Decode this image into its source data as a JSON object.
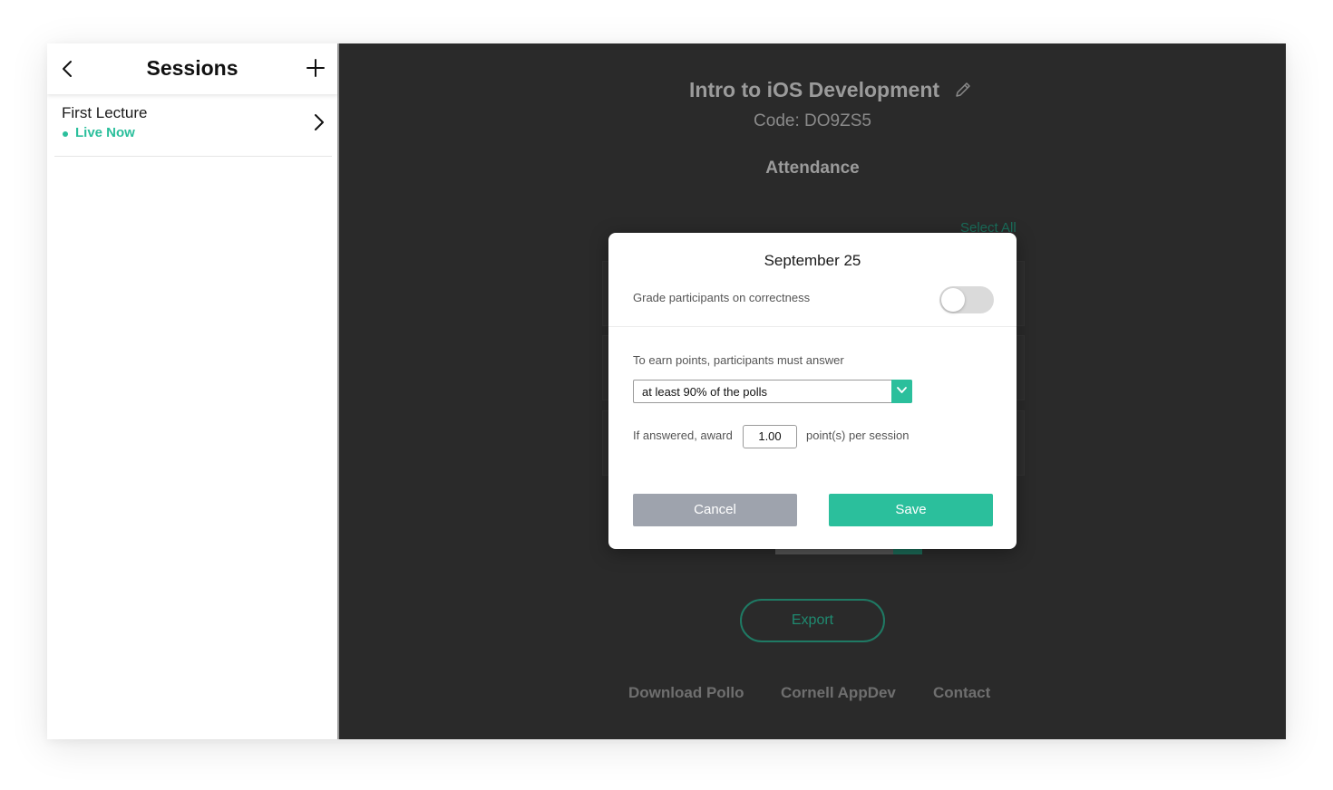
{
  "sidebar": {
    "title": "Sessions",
    "items": [
      {
        "name": "First Lecture",
        "status": "Live Now"
      }
    ]
  },
  "main": {
    "course_title": "Intro to iOS Development",
    "course_code": "Code: DO9ZS5",
    "section_title": "Attendance",
    "select_all": "Select All",
    "export_label": "Export",
    "footer_links": [
      "Download Pollo",
      "Cornell AppDev",
      "Contact"
    ]
  },
  "modal": {
    "title": "September 25",
    "grade_label": "Grade participants on correctness",
    "grade_toggle_on": false,
    "earn_label": "To earn points, participants must answer",
    "requirement_selected": "at least 90% of the polls",
    "award_prefix": "If answered, award",
    "award_value": "1.00",
    "award_suffix": "point(s) per session",
    "cancel_label": "Cancel",
    "save_label": "Save"
  },
  "colors": {
    "accent": "#2bbf9c",
    "main_background": "#2a2a2a",
    "cancel_gray": "#9ea3ad"
  },
  "icons": [
    "chevron-left-icon",
    "plus-icon",
    "chevron-right-icon",
    "pencil-icon",
    "chevron-down-icon"
  ]
}
